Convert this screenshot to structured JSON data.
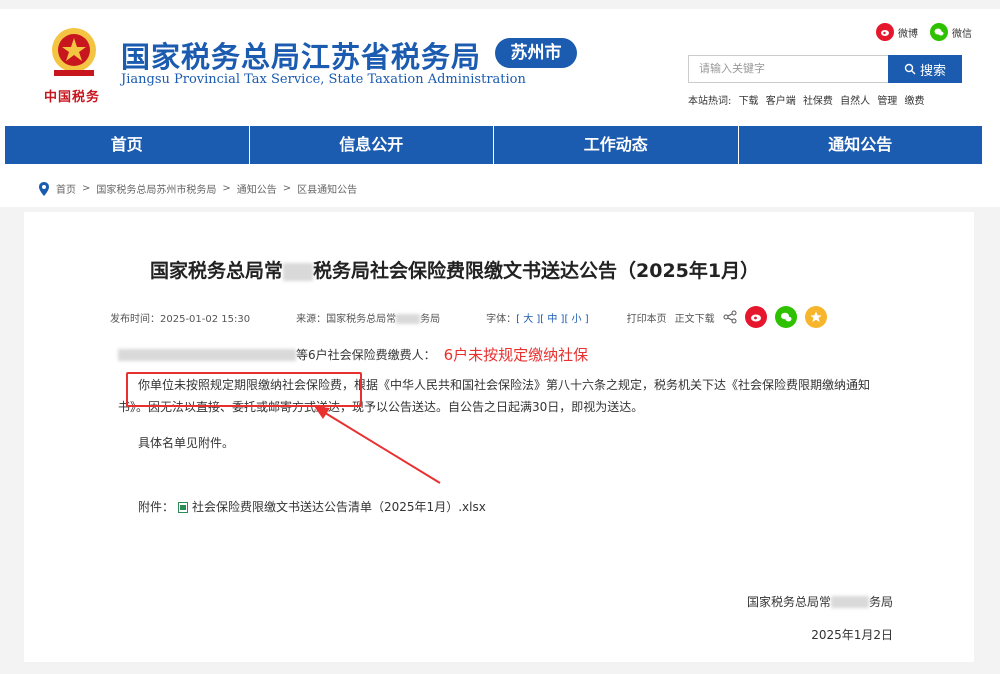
{
  "header": {
    "site_title": "国家税务总局江苏省税务局",
    "site_subtitle": "Jiangsu Provincial Tax Service, State Taxation Administration",
    "city_badge": "苏州市",
    "emblem_text": "中国税务",
    "share": [
      {
        "label": "微博",
        "icon": "weibo-icon"
      },
      {
        "label": "微信",
        "icon": "wechat-icon"
      }
    ],
    "search": {
      "placeholder": "请输入关键字",
      "button": "搜索"
    },
    "hot_label": "本站热词:",
    "hot_words": [
      "下载",
      "客户端",
      "社保费",
      "自然人",
      "管理",
      "缴费"
    ]
  },
  "nav": {
    "items": [
      "首页",
      "信息公开",
      "工作动态",
      "通知公告"
    ]
  },
  "breadcrumb": [
    "首页",
    "国家税务总局苏州市税务局",
    "通知公告",
    "区县通知公告"
  ],
  "breadcrumb_sep": ">",
  "article": {
    "title_part1": "国家税务总局常",
    "title_part2": "税务局社会保险费限缴文书送达公告（2025年1月）",
    "publish": "发布时间：2025-01-02 15:30",
    "source": "来源：国家税务总局常",
    "source_end": "务局",
    "font_label": "字体：",
    "font_sizes": [
      "[ 大 ]",
      "[ 中 ]",
      "[ 小 ]"
    ],
    "print": "打印本页",
    "download": "正文下载",
    "p1_end": "等6户社会保险费缴费人：",
    "annotation": "6户未按规定缴纳社保",
    "p2": "你单位未按照规定期限缴纳社会保险费，根据《中华人民共和国社会保险法》第八十六条之规定，税务机关下达《社会保险费限期缴纳通知书》。因无法以直接、委托或邮寄方式送达，现予以公告送达。自公告之日起满30日，即视为送达。",
    "p3": "具体名单见附件。",
    "attachment_label": "附件：",
    "attachment_name": "社会保险费限缴文书送达公告清单（2025年1月）.xlsx",
    "sign_part1": "国家税务总局常",
    "sign_part2": "务局",
    "date": "2025年1月2日"
  },
  "colors": {
    "brand": "#1b5bb0",
    "accent_red": "#e8312f",
    "weibo": "#e6162d",
    "wechat": "#2dc100",
    "star": "#f7b52c"
  }
}
